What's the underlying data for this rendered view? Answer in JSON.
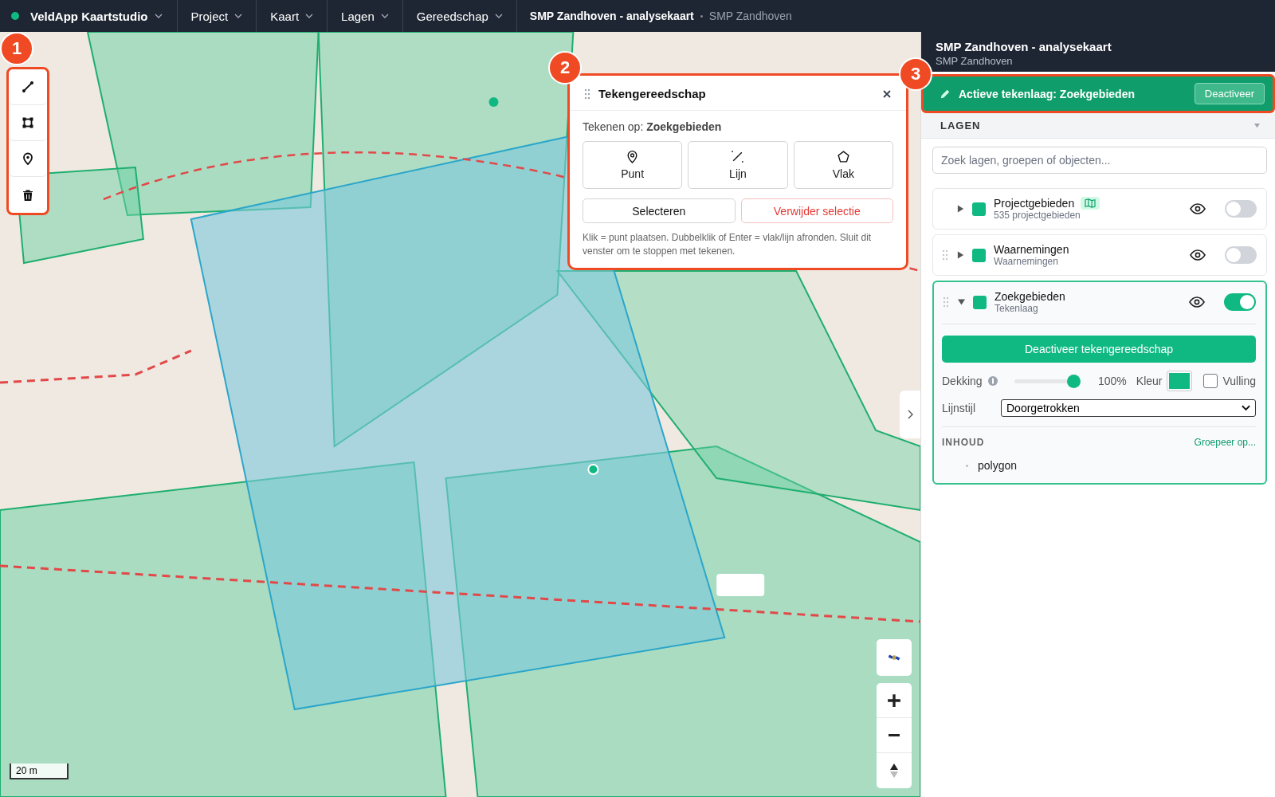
{
  "top_bar": {
    "app_name": "VeldApp Kaartstudio",
    "menus": [
      "Project",
      "Kaart",
      "Lagen",
      "Gereedschap"
    ],
    "map_title": "SMP Zandhoven - analysekaart",
    "map_subtitle": "SMP Zandhoven"
  },
  "callouts": [
    "1",
    "2",
    "3"
  ],
  "draw_toolbar": {
    "tools": [
      {
        "kind": "line"
      },
      {
        "kind": "polygon"
      },
      {
        "kind": "point"
      },
      {
        "kind": "delete"
      }
    ]
  },
  "map": {
    "kind": "picture",
    "scale": "20 m"
  },
  "drawing_panel": {
    "title": "Tekengereedschap",
    "target": "Tekenen op: **Zoekgebieden**",
    "modes": [
      {
        "kind": "point",
        "label": "Punt"
      },
      {
        "kind": "line",
        "label": "Lijn"
      },
      {
        "kind": "polygon",
        "label": "Vlak"
      }
    ],
    "select_button": "Selecteren",
    "delete_button": "Verwijder selectie",
    "hint": "Klik = punt plaatsen. Dubbelklik of Enter = vlak/lijn afronden. Sluit dit venster om te stoppen met tekenen."
  },
  "sidebar": {
    "title": "SMP Zandhoven - analysekaart",
    "subtitle": "SMP Zandhoven",
    "active_layer": "Actieve tekenlaag: Zoekgebieden",
    "deactivate_button": "Deactiveer",
    "layers_heading": "LAGEN",
    "search_placeholder": "Zoek lagen, groepen of objecten...",
    "layers": [
      {
        "name": "Projectgebieden",
        "subtitle": "535 projectgebieden",
        "draggable": false,
        "map_badge": true,
        "expanded": false,
        "visible": false
      },
      {
        "name": "Waarnemingen",
        "subtitle": "Waarnemingen",
        "draggable": true,
        "map_badge": false,
        "expanded": false,
        "visible": false
      },
      {
        "name": "Zoekgebieden",
        "subtitle": "Tekenlaag",
        "draggable": true,
        "map_badge": false,
        "expanded": true,
        "visible": true
      }
    ],
    "details": {
      "button": "Deactiveer tekengereedschap",
      "opacity_label": "Dekking",
      "level": 1.0,
      "opacity_reading": "100%",
      "color_label": "Kleur",
      "fill_label": "Vulling",
      "fill_checked": false,
      "line_style_label": "Lijnstijl",
      "line_style": "Doorgetrokken",
      "contents_heading": "INHOUD",
      "group_link": "Groepeer op...",
      "items": [
        "polygon"
      ]
    }
  }
}
